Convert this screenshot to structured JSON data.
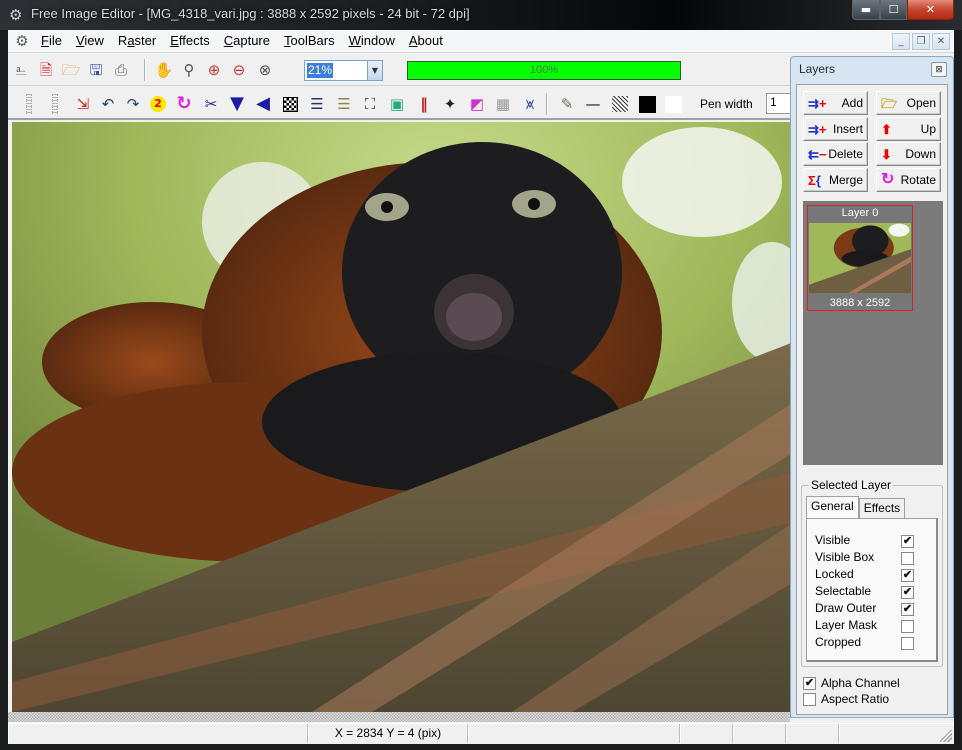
{
  "window": {
    "title": "Free Image Editor - [MG_4318_vari.jpg : 3888 x 2592 pixels - 24 bit - 72 dpi]",
    "controls": {
      "minimize": "minimize",
      "maximize": "maximize",
      "close": "close"
    }
  },
  "menubar": {
    "items": [
      {
        "label": "File",
        "accel": "F"
      },
      {
        "label": "View",
        "accel": "V"
      },
      {
        "label": "Raster",
        "accel": "a"
      },
      {
        "label": "Effects",
        "accel": "E"
      },
      {
        "label": "Capture",
        "accel": "C"
      },
      {
        "label": "ToolBars",
        "accel": "T"
      },
      {
        "label": "Window",
        "accel": "W"
      },
      {
        "label": "About",
        "accel": "A"
      }
    ]
  },
  "toolbar1": {
    "icons": [
      "scanner-icon",
      "new-icon",
      "open-folder-icon",
      "save-icon",
      "print-icon",
      "hand-pan-icon",
      "zoom-icon",
      "zoom-in-icon",
      "zoom-out-icon",
      "zoom-fit-icon"
    ],
    "zoom_value": "21%",
    "progress": {
      "value_percent": 100,
      "label": "100%",
      "color": "#00ff00"
    }
  },
  "toolbar2": {
    "icons": [
      "convert-icon",
      "rotate-left-icon",
      "rotate-right-icon",
      "step2-icon",
      "rotate-icon",
      "cut-paste-icon",
      "flip-vertical-icon",
      "flip-horizontal-icon",
      "checker-icon",
      "layers-back-icon",
      "layers-front-icon",
      "crop-page-icon",
      "frame-icon",
      "color-channels-icon",
      "magic-icon",
      "gradient-icon",
      "grid-icon",
      "histogram-icon",
      "pen-tool-icon",
      "line-style-icon",
      "hatch-pattern-icon",
      "foreground-color",
      "background-color"
    ],
    "colors": {
      "foreground": "#000000",
      "background": "#ffffff"
    },
    "pen_width_label": "Pen width",
    "pen_width_value": "1"
  },
  "layers_panel": {
    "title": "Layers",
    "buttons": [
      {
        "label": "Add",
        "icon": "add-layer-icon"
      },
      {
        "label": "Open",
        "icon": "open-folder-icon"
      },
      {
        "label": "Insert",
        "icon": "insert-layer-icon"
      },
      {
        "label": "Up",
        "icon": "arrow-up-icon"
      },
      {
        "label": "Delete",
        "icon": "delete-layer-icon"
      },
      {
        "label": "Down",
        "icon": "arrow-down-icon"
      },
      {
        "label": "Merge",
        "icon": "merge-icon"
      },
      {
        "label": "Rotate",
        "icon": "rotate-icon"
      }
    ],
    "layers": [
      {
        "name": "Layer 0",
        "size": "3888 x 2592",
        "selected": true
      }
    ],
    "selected_layer": {
      "legend": "Selected Layer",
      "tabs": [
        {
          "label": "General",
          "active": true
        },
        {
          "label": "Effects",
          "active": false
        }
      ],
      "properties": [
        {
          "label": "Visible",
          "checked": true
        },
        {
          "label": "Visible Box",
          "checked": false
        },
        {
          "label": "Locked",
          "checked": true
        },
        {
          "label": "Selectable",
          "checked": true
        },
        {
          "label": "Draw Outer",
          "checked": true
        },
        {
          "label": "Layer Mask",
          "checked": false
        },
        {
          "label": "Cropped",
          "checked": false
        }
      ]
    },
    "options": [
      {
        "label": "Alpha Channel",
        "checked": true
      },
      {
        "label": "Aspect Ratio",
        "checked": false
      }
    ]
  },
  "statusbar": {
    "cells": [
      "",
      "X = 2834   Y = 4 (pix)",
      "",
      "",
      "",
      "",
      ""
    ]
  },
  "check_glyph": "✔"
}
